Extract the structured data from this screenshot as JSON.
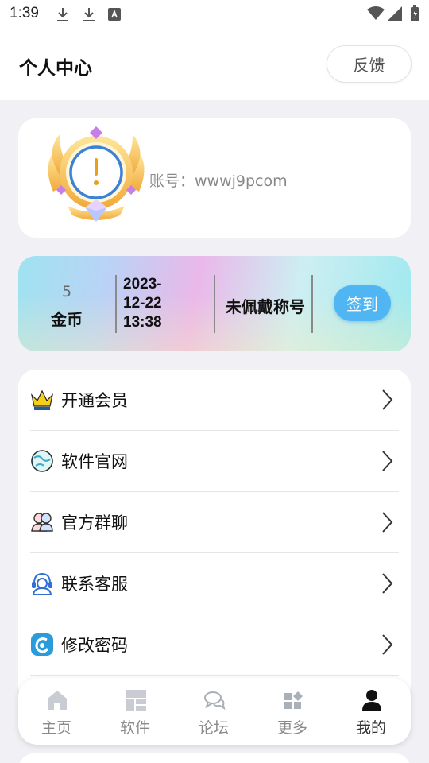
{
  "status_bar": {
    "time": "1:39"
  },
  "header": {
    "title": "个人中心",
    "feedback_label": "反馈"
  },
  "profile": {
    "account": "账号：wwwj9pcom"
  },
  "stats": {
    "coins_value": "5",
    "coins_label": "金币",
    "date_line1": "2023-",
    "date_line2": "12-22",
    "date_line3": "13:38",
    "title_status": "未佩戴称号",
    "checkin_label": "签到"
  },
  "menu": {
    "items": [
      {
        "label": "开通会员",
        "icon": "crown-icon"
      },
      {
        "label": "软件官网",
        "icon": "globe-icon"
      },
      {
        "label": "官方群聊",
        "icon": "group-chat-icon"
      },
      {
        "label": "联系客服",
        "icon": "customer-service-icon"
      },
      {
        "label": "修改密码",
        "icon": "password-icon"
      }
    ]
  },
  "nav": {
    "items": [
      {
        "label": "主页",
        "icon": "home-icon"
      },
      {
        "label": "软件",
        "icon": "apps-icon"
      },
      {
        "label": "论坛",
        "icon": "forum-icon"
      },
      {
        "label": "更多",
        "icon": "more-icon"
      },
      {
        "label": "我的",
        "icon": "profile-icon",
        "active": true
      }
    ]
  },
  "colors": {
    "accent": "#4fb6f3",
    "background": "#f1f1f5",
    "card": "#ffffff"
  }
}
